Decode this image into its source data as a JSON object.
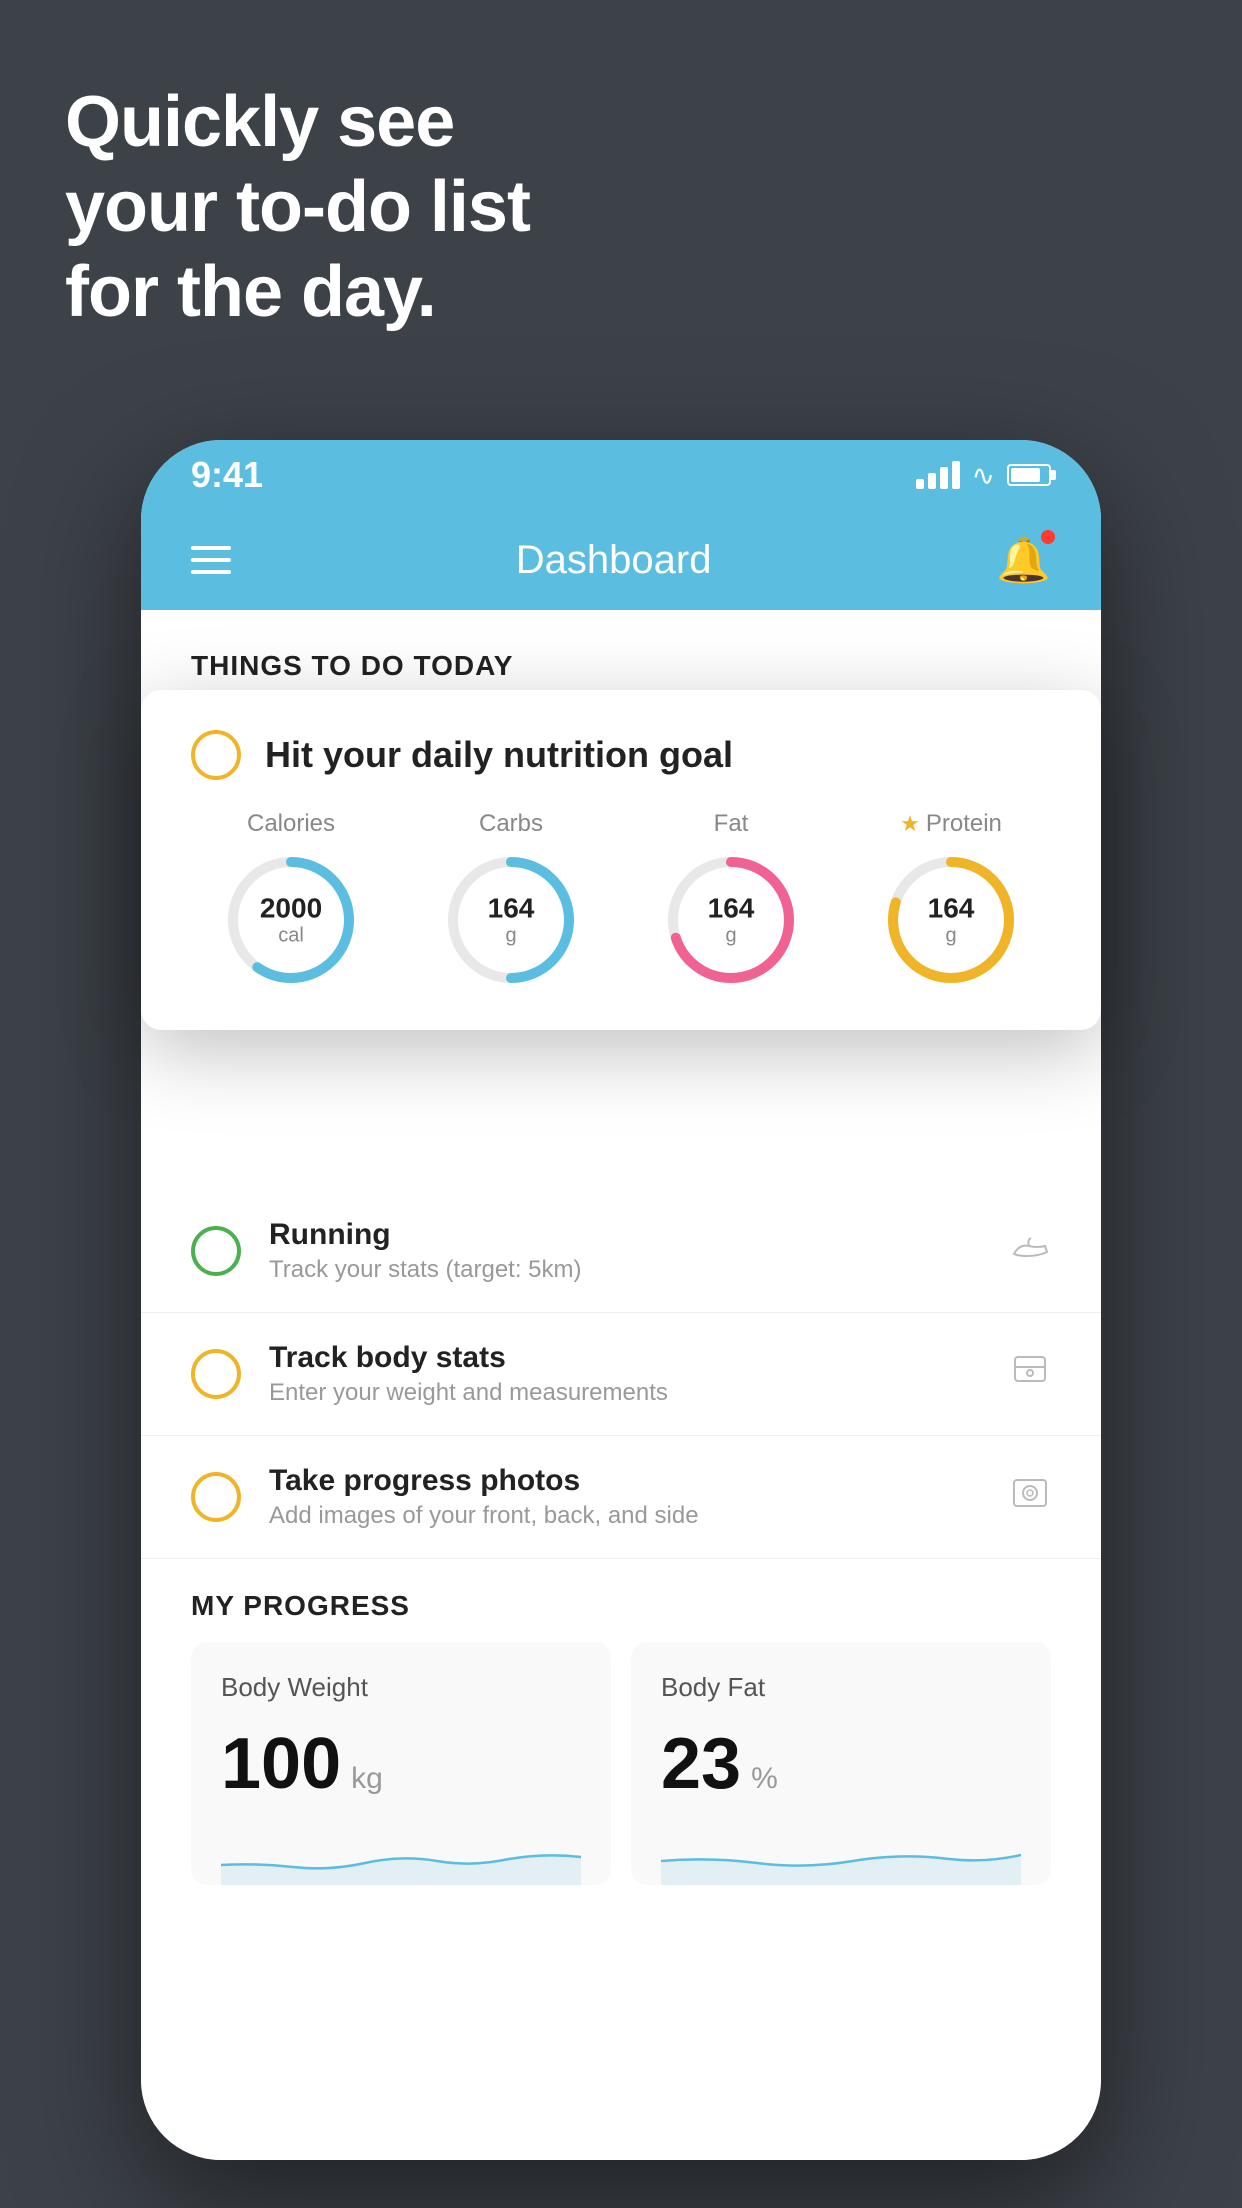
{
  "background": {
    "color": "#3d4249"
  },
  "hero": {
    "line1": "Quickly see",
    "line2": "your to-do list",
    "line3": "for the day."
  },
  "phone": {
    "status_bar": {
      "time": "9:41",
      "signal": "signal-icon",
      "wifi": "wifi-icon",
      "battery": "battery-icon"
    },
    "nav": {
      "title": "Dashboard",
      "menu": "menu-icon",
      "bell": "bell-icon"
    },
    "things_section": {
      "header": "THINGS TO DO TODAY"
    },
    "nutrition_card": {
      "circle_color": "#f0b429",
      "title": "Hit your daily nutrition goal",
      "macros": [
        {
          "label": "Calories",
          "value": "2000",
          "unit": "cal",
          "color": "#5bbee0",
          "progress": 0.6
        },
        {
          "label": "Carbs",
          "value": "164",
          "unit": "g",
          "color": "#5bbee0",
          "progress": 0.5
        },
        {
          "label": "Fat",
          "value": "164",
          "unit": "g",
          "color": "#f06292",
          "progress": 0.7
        },
        {
          "label": "Protein",
          "value": "164",
          "unit": "g",
          "color": "#f0b429",
          "progress": 0.8,
          "star": true
        }
      ]
    },
    "todo_items": [
      {
        "icon_color": "green",
        "title": "Running",
        "subtitle": "Track your stats (target: 5km)",
        "action_icon": "shoe-icon"
      },
      {
        "icon_color": "yellow",
        "title": "Track body stats",
        "subtitle": "Enter your weight and measurements",
        "action_icon": "scale-icon"
      },
      {
        "icon_color": "yellow",
        "title": "Take progress photos",
        "subtitle": "Add images of your front, back, and side",
        "action_icon": "photo-icon"
      }
    ],
    "progress_section": {
      "header": "MY PROGRESS",
      "cards": [
        {
          "title": "Body Weight",
          "value": "100",
          "unit": "kg"
        },
        {
          "title": "Body Fat",
          "value": "23",
          "unit": "%"
        }
      ]
    }
  }
}
